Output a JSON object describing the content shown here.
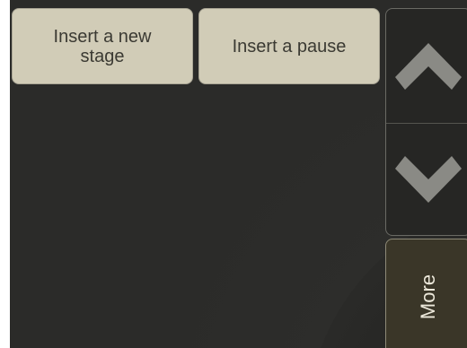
{
  "toolbar": {
    "insert_stage_label": "Insert a new stage",
    "insert_pause_label": "Insert a pause"
  },
  "side_panel": {
    "scroll_up_icon": "chevron-up-icon",
    "scroll_down_icon": "chevron-down-icon",
    "more_label": "More"
  },
  "colors": {
    "button_fill": "#d1ccb7",
    "background": "#2b2b29",
    "chevron": "#8a8a85",
    "more_fill": "#3a3628"
  }
}
